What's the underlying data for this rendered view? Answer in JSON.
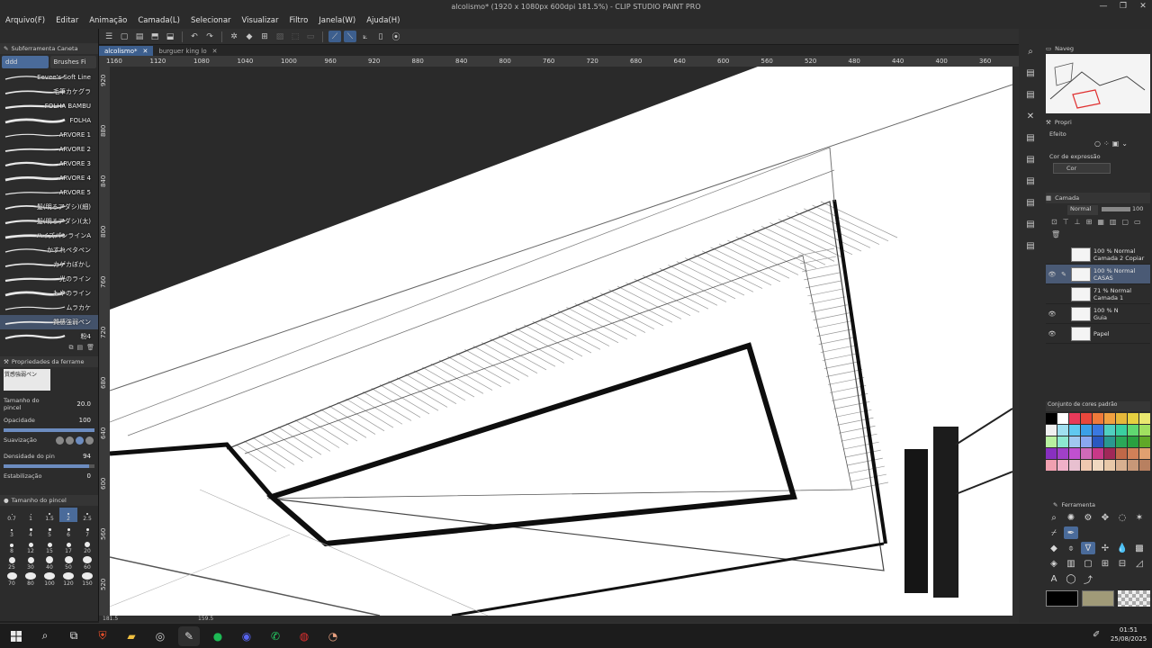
{
  "window": {
    "title": "alcolismo* (1920 x 1080px 600dpi 181.5%) - CLIP STUDIO PAINT PRO"
  },
  "menu": [
    "Arquivo(F)",
    "Editar",
    "Animação",
    "Camada(L)",
    "Selecionar",
    "Visualizar",
    "Filtro",
    "Janela(W)",
    "Ajuda(H)"
  ],
  "left_panel": {
    "subtool_header": "Subferramenta Caneta",
    "tab_active": "ddd",
    "tab_other": "Brushes Fi",
    "brushes": [
      {
        "name": "Eevee's Soft Line"
      },
      {
        "name": "毛筆カケグラ"
      },
      {
        "name": "FOLHA BAMBU"
      },
      {
        "name": "FOLHA"
      },
      {
        "name": "ARVORE 1"
      },
      {
        "name": "ARVORE 2"
      },
      {
        "name": "ARVORE 3"
      },
      {
        "name": "ARVORE 4"
      },
      {
        "name": "ARVORE 5"
      },
      {
        "name": "髪(明るアダシ)(細)"
      },
      {
        "name": "髪(明るアダシ)(太)"
      },
      {
        "name": "ハイズパンラインA"
      },
      {
        "name": "かすれペタペン"
      },
      {
        "name": "カゲカぼかし"
      },
      {
        "name": "光のライン"
      },
      {
        "name": "もやのライン"
      },
      {
        "name": "ムラカケ"
      },
      {
        "name": "質感強弱ペン"
      },
      {
        "name": "粉4"
      }
    ],
    "selected_brush_index": 17,
    "properties_header": "Propriedades da ferrame",
    "properties_preview_label": "質感強弱ペン",
    "props": {
      "size_label": "Tamanho do pincel",
      "size_value": "20.0",
      "opacity_label": "Opacidade",
      "opacity_value": "100",
      "opacity_fill": 1.0,
      "smooth_label": "Suavização",
      "density_label": "Densidade do pin",
      "density_value": "94",
      "density_fill": 0.94,
      "stabil_label": "Estabilização",
      "stabil_value": "0"
    },
    "brush_size_header": "Tamanho do pincel",
    "brush_sizes": [
      "0.7",
      "1",
      "1.5",
      "2",
      "2.5",
      "3",
      "4",
      "5",
      "6",
      "7",
      "8",
      "12",
      "15",
      "17",
      "20",
      "25",
      "30",
      "40",
      "50",
      "60",
      "70",
      "80",
      "100",
      "120",
      "150"
    ],
    "active_size": "2"
  },
  "tabs": [
    {
      "label": "alcolismo*",
      "active": true
    },
    {
      "label": "burguer king lo",
      "active": false
    }
  ],
  "ruler_top": [
    "1160",
    "1120",
    "1080",
    "1040",
    "1000",
    "960",
    "920",
    "880",
    "840",
    "800",
    "760",
    "720",
    "680",
    "640",
    "600",
    "560",
    "520",
    "480",
    "440",
    "400",
    "360"
  ],
  "ruler_left": [
    "920",
    "880",
    "840",
    "800",
    "760",
    "720",
    "680",
    "640",
    "600",
    "560",
    "520"
  ],
  "status": {
    "zoom": "181.5",
    "angle": "159.5"
  },
  "right_panel": {
    "navigator_label": "Naveg",
    "props_label": "Propri",
    "effect_label": "Efeito",
    "expression_label": "Cor de expressão",
    "expression_value": "Cor",
    "layer_tab": "Camada",
    "blend_mode": "Normal",
    "opacity": "100",
    "layers": [
      {
        "opacity": "100 % Normal",
        "name": "Camada 2 Copiar",
        "selected": false,
        "visible": false
      },
      {
        "opacity": "100 % Normal",
        "name": "CASAS",
        "selected": true,
        "visible": true
      },
      {
        "opacity": "71 % Normal",
        "name": "Camada 1",
        "selected": false,
        "visible": false
      },
      {
        "opacity": "100 % N",
        "name": "Guia",
        "selected": false,
        "visible": true
      },
      {
        "opacity": "",
        "name": "Papel",
        "selected": false,
        "visible": true
      }
    ],
    "color_set_label": "Conjunto de cores padrão",
    "tools_label": "Ferramenta"
  },
  "colors": {
    "palette": [
      "#000000",
      "#ffffff",
      "#e83a5a",
      "#e8473c",
      "#ef7a3a",
      "#f0a040",
      "#e6b83a",
      "#e6d040",
      "#eae870",
      "#f0f0f0",
      "#a0e0f0",
      "#60c8f0",
      "#3aa0e8",
      "#3a78e0",
      "#50d0c0",
      "#3ad0a0",
      "#60d870",
      "#a0e060",
      "#b8f0a0",
      "#8ce8d0",
      "#a0c8f0",
      "#8aa8f0",
      "#2a58c0",
      "#2a9890",
      "#2aa858",
      "#2aa040",
      "#60a828",
      "#8830c0",
      "#a040c8",
      "#c050d0",
      "#d06ab8",
      "#c83888",
      "#a02858",
      "#c06848",
      "#d08058",
      "#e0a070",
      "#f0a0b0",
      "#f0b0c8",
      "#e8c0d0",
      "#f0c8b0",
      "#f0d8c0",
      "#e8c8a8",
      "#d8b090",
      "#c89878",
      "#b88060"
    ],
    "primary": "#000000",
    "secondary": "#a09a78"
  },
  "taskbar": {
    "time": "01:51",
    "date": "25/08/2025"
  }
}
